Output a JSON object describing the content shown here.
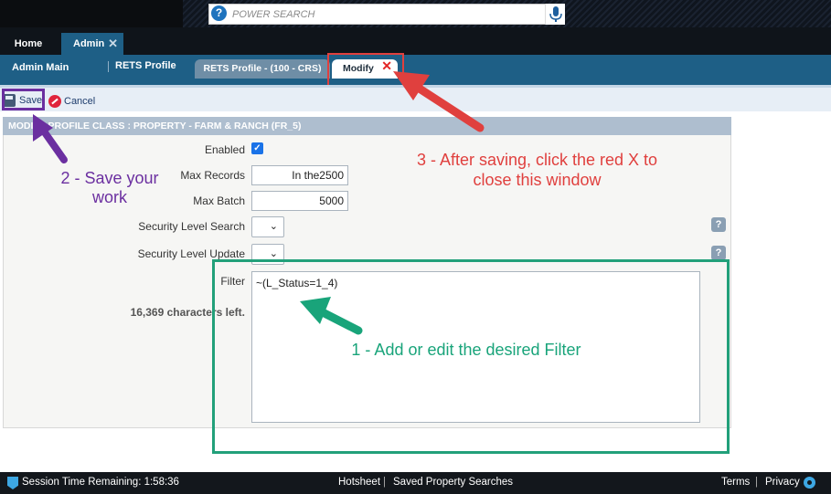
{
  "search": {
    "placeholder": "POWER SEARCH",
    "help_glyph": "?"
  },
  "tabs": {
    "home": "Home",
    "admin": "Admin",
    "close_glyph": "✕"
  },
  "subnav": {
    "admin_main": "Admin Main",
    "rets_profile": "RETS Profile",
    "profile_tab": "RETS Profile - (100 - CRS)",
    "modify_tab": "Modify",
    "close_glyph": "✕"
  },
  "toolbar": {
    "save_label": "Save",
    "cancel_label": "Cancel"
  },
  "panel": {
    "header": "MODIFY PROFILE CLASS : PROPERTY - FARM & RANCH (FR_5)",
    "fields": {
      "enabled_label": "Enabled",
      "enabled_checked": true,
      "max_records_label": "Max Records",
      "max_records_value": "In the2500",
      "max_batch_label": "Max Batch",
      "max_batch_value": "5000",
      "sec_search_label": "Security Level Search",
      "sec_update_label": "Security Level Update",
      "filter_label": "Filter",
      "filter_value": "~(L_Status=1_4)",
      "chars_left": "16,369 characters left."
    },
    "help_glyph": "?"
  },
  "annotations": {
    "step1": "1 - Add or edit the desired Filter",
    "step2": "2 - Save your work",
    "step3": "3 - After saving, click the red X to close this window",
    "colors": {
      "step1": "#19a47a",
      "step2": "#6b2fa0",
      "step3": "#e0403e"
    }
  },
  "footer": {
    "session": "Session Time Remaining: 1:58:36",
    "hotsheet": "Hotsheet",
    "saved_searches": "Saved Property Searches",
    "terms": "Terms",
    "privacy": "Privacy",
    "separator": "|"
  },
  "icons": [
    "help-icon",
    "microphone-icon",
    "close-icon",
    "save-icon",
    "cancel-icon",
    "checkbox-checked-icon",
    "chevron-down-icon",
    "shield-icon",
    "gear-icon"
  ],
  "colors": {
    "nav_blue": "#1e5f86",
    "toolbar_bg": "#e7eef6",
    "panel_header": "#aebecf"
  }
}
